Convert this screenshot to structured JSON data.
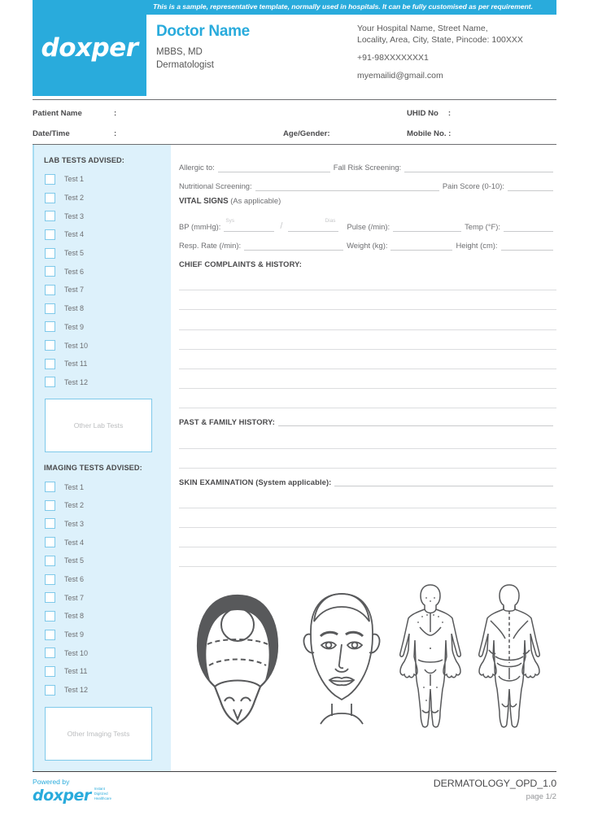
{
  "banner": {
    "text": "This is a sample, representative template, normally used in hospitals. It can be fully customised as per requirement."
  },
  "brand": {
    "logo_word": "doxper",
    "accent_color": "#29abdc",
    "sidebar_bg": "#ddf1fb",
    "checkbox_border": "#7ec9ea"
  },
  "header": {
    "doctor_name": "Doctor Name",
    "qualification": "MBBS, MD",
    "specialty": "Dermatologist",
    "hospital_line1": "Your Hospital Name, Street Name,",
    "hospital_line2": "Locality, Area, City, State, Pincode: 100XXX",
    "phone": "+91-98XXXXXXX1",
    "email": "myemailid@gmail.com"
  },
  "patient": {
    "name_label": "Patient Name",
    "name_colon": ":",
    "uhid_label": "UHID No",
    "uhid_colon": ":",
    "datetime_label": "Date/Time",
    "datetime_colon": ":",
    "age_gender_label": "Age/Gender:",
    "mobile_label": "Mobile No. :"
  },
  "sidebar": {
    "lab_heading": "LAB TESTS ADVISED:",
    "lab_tests": [
      "Test 1",
      "Test 2",
      "Test 3",
      "Test 4",
      "Test 5",
      "Test 6",
      "Test 7",
      "Test 8",
      "Test 9",
      "Test 10",
      "Test 11",
      "Test 12"
    ],
    "other_lab_placeholder": "Other Lab Tests",
    "imaging_heading": "IMAGING TESTS ADVISED:",
    "imaging_tests": [
      "Test 1",
      "Test 2",
      "Test 3",
      "Test 4",
      "Test 5",
      "Test 6",
      "Test 7",
      "Test 8",
      "Test 9",
      "Test 10",
      "Test 11",
      "Test 12"
    ],
    "other_imaging_placeholder": "Other Imaging Tests"
  },
  "main": {
    "allergic_label": "Allergic to:",
    "fall_risk_label": "Fall Risk Screening:",
    "nutritional_label": "Nutritional Screening:",
    "pain_score_label": "Pain Score (0-10):",
    "vital_signs_title": "VITAL SIGNS",
    "vital_signs_note": "(As applicable)",
    "bp_label": "BP (mmHg):",
    "bp_sys_hint": "Sys",
    "bp_dias_hint": "Dias",
    "bp_separator": "/",
    "pulse_label": "Pulse (/min):",
    "temp_label": "Temp (°F):",
    "resp_rate_label": "Resp. Rate (/min):",
    "weight_label": "Weight (kg):",
    "height_label": "Height (cm):",
    "chief_complaints_heading": "CHIEF COMPLAINTS & HISTORY:",
    "chief_complaints_lines": 7,
    "past_family_heading": "PAST & FAMILY HISTORY:",
    "past_family_lines": 2,
    "skin_exam_heading": "SKIN EXAMINATION (System applicable):",
    "skin_exam_lines": 4,
    "diagrams": [
      "scalp-hair-pattern-diagram",
      "face-front-diagram",
      "body-anterior-diagram",
      "body-posterior-diagram"
    ]
  },
  "footer": {
    "powered_by": "Powered by",
    "logo_word": "doxper",
    "tagline_line1": "Instant",
    "tagline_line2": "Digitized",
    "tagline_line3": "Healthcare",
    "form_code": "DERMATOLOGY_OPD_1.0",
    "page_number": "page 1/2"
  }
}
